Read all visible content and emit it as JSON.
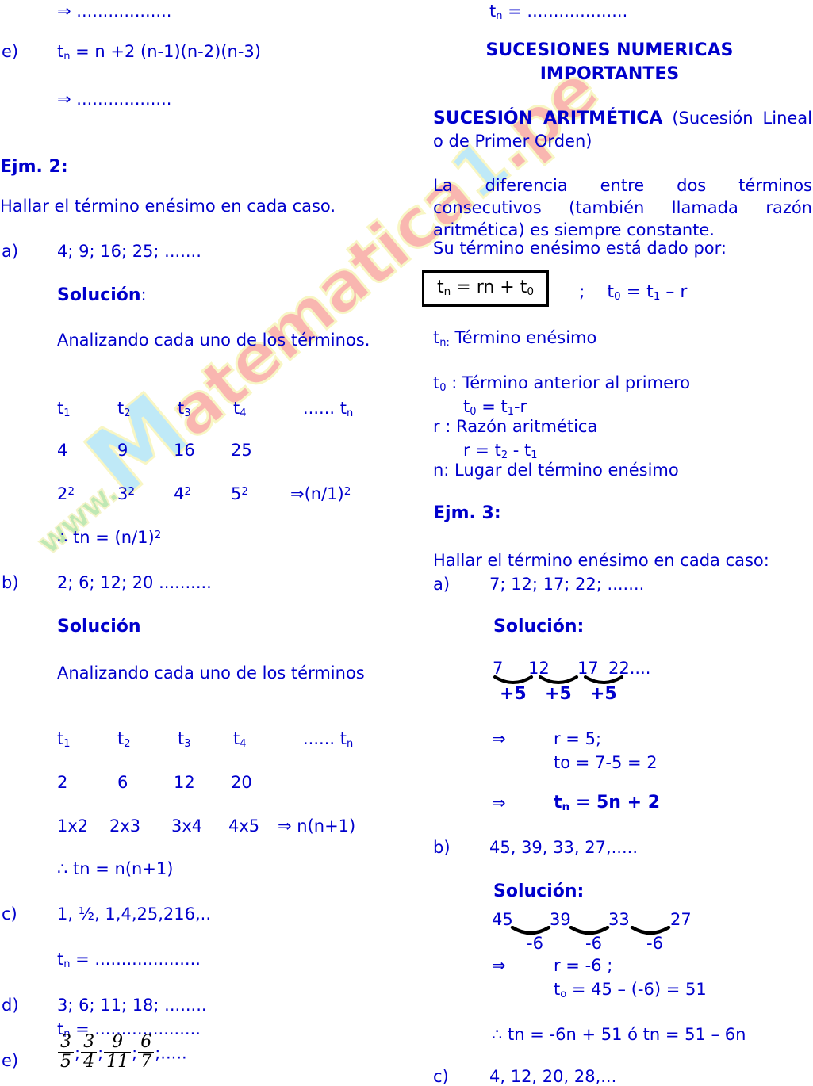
{
  "colors": {
    "text_blue": "#0000cc",
    "black": "#000000",
    "watermark_blue": "#bfe9f7",
    "watermark_pink": "#f9b6b0",
    "watermark_green": "#bfe8b4",
    "watermark_outline": "#f8f6c4"
  },
  "watermark": {
    "www": "www.",
    "m": "M",
    "mid": "atematica",
    "one": "1",
    "pe": ".pe"
  },
  "left": {
    "top_arrow_dots": "⇒ ..................",
    "item_e_label": "e)",
    "item_e_formula_prefix": "t",
    "item_e_formula_sub": "n",
    "item_e_formula_rest": " =  n +2 (n-1)(n-2)(n-3)",
    "arrow_dots_2": "⇒ ..................",
    "ejm2_title": "Ejm. 2:",
    "ejm2_instruction": "Hallar el término enésimo en cada caso.",
    "a_label": "a)",
    "a_sequence": "4; 9; 16; 25; .......",
    "a_solucion": "Solución",
    "a_solucion_colon": ":",
    "a_analizando": "Analizando cada uno de los términos.",
    "terms_header": [
      "t",
      "t",
      "t",
      "t",
      "...... t"
    ],
    "terms_header_subs": [
      "1",
      "2",
      "3",
      "4",
      "n"
    ],
    "a_values": [
      "4",
      "9",
      "16",
      "25"
    ],
    "a_squares": [
      "2",
      "3",
      "4",
      "5"
    ],
    "a_squares_exp": "2",
    "a_implies": "⇒(n/1)",
    "a_implies_exp": "2",
    "a_conclusion": "∴ tn = (n/1)",
    "a_conclusion_exp": "2",
    "b_label": "b)",
    "b_sequence": "2; 6; 12; 20 ..........",
    "b_solucion": "Solución",
    "b_analizando": "Analizando cada uno de los términos",
    "b_values": [
      "2",
      "6",
      "12",
      "20"
    ],
    "b_products": [
      "1x2",
      "2x3",
      "3x4",
      "4x5"
    ],
    "b_implies": "⇒ n(n+1)",
    "b_conclusion": "∴ tn = n(n+1)",
    "c_label": "c)",
    "c_sequence": "1, ½, 1,4,25,216,..",
    "c_tn_prefix": "t",
    "c_tn_sub": "n",
    "c_tn_rest": " = ....................",
    "d_label": "d)",
    "d_sequence": "3; 6; 11; 18; ........",
    "d_tn_prefix": "t",
    "d_tn_sub": "n",
    "d_tn_rest": " = ....................",
    "e2_label": "e)",
    "e2_fractions": [
      {
        "num": "3",
        "den": "5"
      },
      {
        "num": "3",
        "den": "4"
      },
      {
        "num": "9",
        "den": "11"
      },
      {
        "num": "6",
        "den": "7"
      }
    ],
    "e2_separator": ";",
    "e2_tail": ";....."
  },
  "right": {
    "top_tn_prefix": "t",
    "top_tn_sub": "n",
    "top_tn_rest": " = ...................",
    "heading_line1": "SUCESIONES NUMERICAS",
    "heading_line2": "IMPORTANTES",
    "subheading_bold": "SUCESIÓN    ARITMÉTICA",
    "subheading_rest": "(Sucesión Lineal o de Primer Orden)",
    "definition": "La diferencia entre dos términos consecutivos (también llamada razón aritmética) es siempre constante.",
    "definition_line2": "Su término enésimo está  dado por:",
    "formula_box": "tₙ = rn + t₀",
    "formula_box_parts": {
      "t": "t",
      "n": "n",
      "mid": " = rn + t",
      "zero": "0"
    },
    "formula_side": {
      "semi": ";",
      "t": "t",
      "zero": "0",
      "mid": " = t",
      "one": "1",
      "tail": " – r"
    },
    "legend": [
      {
        "sym": "t",
        "sub": "n:",
        "text": " Término enésimo"
      },
      {
        "sym": "t",
        "sub": "0",
        "text": " : Término anterior al primero"
      },
      {
        "sym": "",
        "sub": "",
        "text": "t₀ = t₁-r",
        "indent": true
      },
      {
        "sym": "r",
        "sub": "",
        "text": " : Razón aritmética"
      },
      {
        "sym": "",
        "sub": "",
        "text": "r  =  t₂ -  t₁",
        "indent": true
      },
      {
        "sym": "n",
        "sub": "",
        "text": ": Lugar del término enésimo"
      }
    ],
    "ejm3_title": "Ejm. 3:",
    "ejm3_instruction": "Hallar el término enésimo en cada caso:",
    "a_label": "a)",
    "a_sequence": "7; 12; 17; 22; .......",
    "a_solucion": "Solución:",
    "a_chain": [
      "7",
      "12",
      "17",
      "22...."
    ],
    "a_diffs": [
      "+5",
      "+5",
      "+5"
    ],
    "a_arrow": "⇒",
    "a_r": "r = 5;",
    "a_t0": "to = 7-5 = 2",
    "a_result_arrow": "⇒",
    "a_result_prefix": "t",
    "a_result_sub": "n",
    "a_result_rest": " = 5n + 2",
    "b_label": "b)",
    "b_sequence": "45, 39, 33, 27,.....",
    "b_solucion": "Solución:",
    "b_chain": [
      "45",
      "39",
      "33",
      "27"
    ],
    "b_diffs": [
      "-6",
      "-6",
      "-6"
    ],
    "b_arrow": "⇒",
    "b_r": "r = -6 ;",
    "b_t0_prefix": "t",
    "b_t0_sub": "o",
    "b_t0_rest": "  = 45 – (-6) = 51",
    "b_conclusion": "∴ tn = -6n + 51 ó  tn = 51 – 6n",
    "c_label": "c)",
    "c_sequence": "4,  12,  20,  28,..."
  }
}
